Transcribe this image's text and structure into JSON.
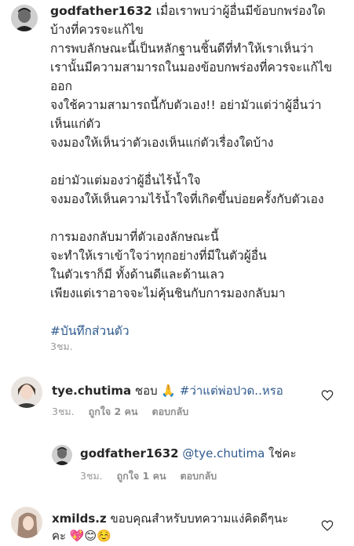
{
  "post": {
    "username": "godfather1632",
    "caption_lines": [
      "เมื่อเราพบว่าผู้อื่นมีข้อบกพร่องใด",
      "บ้างที่ควรจะแก้ไข",
      "การพบลักษณะนี้เป็นหลักฐานชิ้นดีที่ทำให้เราเห็นว่า",
      "เรานั้นมีความสามารถในมองข้อบกพร่องที่ควรจะแก้ไข",
      "ออก",
      "จงใช้ความสามารถนี้กับตัวเอง!! อย่ามัวแต่ว่าผู้อื่นว่า",
      "เห็นแก่ตัว",
      "จงมองให้เห็นว่าตัวเองเห็นแก่ตัวเรื่องใดบ้าง",
      "",
      "อย่ามัวแต่มองว่าผู้อื่นไร้น้ำใจ",
      "จงมองให้เห็นความไร้น้ำใจที่เกิดขึ้นบ่อยครั้งกับตัวเอง",
      "",
      "การมองกลับมาที่ตัวเองลักษณะนี้",
      "จะทำให้เราเข้าใจว่าทุกอย่างที่มีในตัวผู้อื่น",
      "ในตัวเราก็มี ทั้งด้านดีและด้านเลว",
      "เพียงแต่เราอาจจะไม่คุ้นชินกับการมองกลับมา",
      ""
    ],
    "hashtag": "#บันทึกส่วนตัว",
    "time": "3ชม."
  },
  "comments": [
    {
      "username": "tye.chutima",
      "text_before": "ชอบ",
      "emoji": "🙏",
      "hashtag": "#ว่าแต่พ่อปวด..หรอ",
      "time": "3ชม.",
      "likes": "ถูกใจ 2 คน",
      "reply_label": "ตอบกลับ"
    },
    {
      "username": "godfather1632",
      "mention": "@tye.chutima",
      "text": "ใช่คะ",
      "time": "3ชม.",
      "likes": "ถูกใจ 1 คน",
      "reply_label": "ตอบกลับ"
    },
    {
      "username": "xmilds.z",
      "text_line1": "ขอบคุณสำหรับบทความแง่คิดดีๆนะ",
      "text_line2": "คะ",
      "emojis": "💖😊☺️"
    }
  ],
  "icons": {
    "like": "heart-outline-icon"
  },
  "colors": {
    "text": "#262626",
    "meta": "#999999",
    "hashtag": "#2f5a8e"
  }
}
